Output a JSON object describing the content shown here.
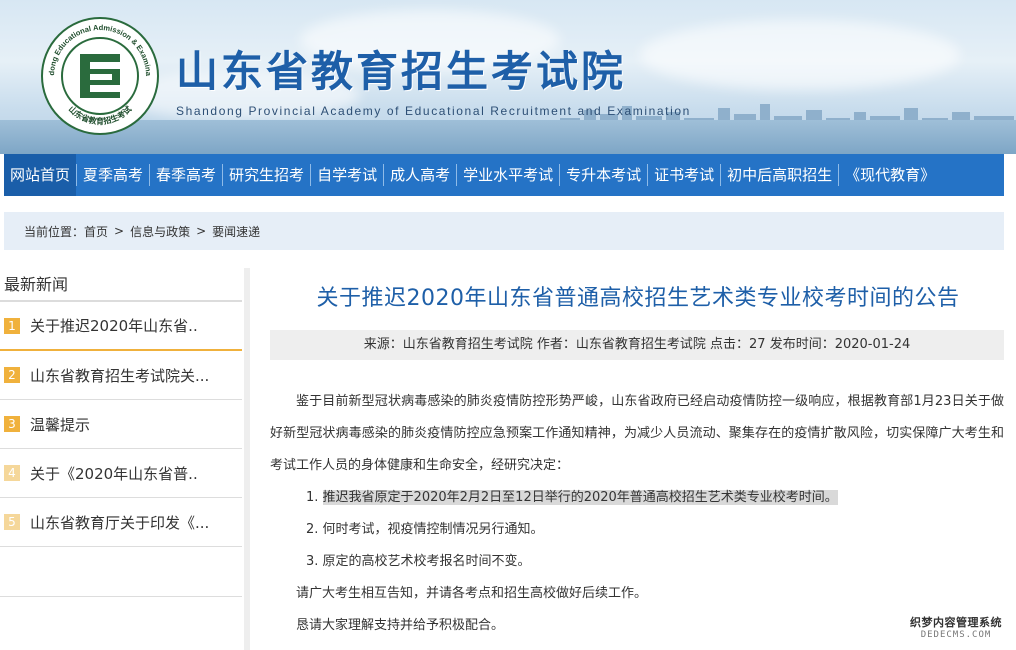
{
  "header": {
    "title": "山东省教育招生考试院",
    "subtitle": "Shandong Provincial Academy of Educational Recruitment and Examination",
    "logo": {
      "ring_text": "Shandong Educational Admission & Examinations",
      "inner_text": "山东省教育招生考试",
      "letter": "E"
    }
  },
  "nav": {
    "items": [
      {
        "label": "网站首页",
        "active": true
      },
      {
        "label": "夏季高考"
      },
      {
        "label": "春季高考"
      },
      {
        "label": "研究生招考"
      },
      {
        "label": "自学考试"
      },
      {
        "label": "成人高考"
      },
      {
        "label": "学业水平考试"
      },
      {
        "label": "专升本考试"
      },
      {
        "label": "证书考试"
      },
      {
        "label": "初中后高职招生"
      },
      {
        "label": "《现代教育》"
      }
    ]
  },
  "breadcrumb": {
    "prefix": "当前位置：",
    "items": [
      "首页",
      "信息与政策",
      "要闻速递"
    ],
    "sep": ">"
  },
  "sidebar": {
    "title": "最新新闻",
    "items": [
      {
        "num": "1",
        "label": "关于推迟2020年山东省.."
      },
      {
        "num": "2",
        "label": "山东省教育招生考试院关..."
      },
      {
        "num": "3",
        "label": "温馨提示"
      },
      {
        "num": "4",
        "label": "关于《2020年山东省普.."
      },
      {
        "num": "5",
        "label": "山东省教育厅关于印发《..."
      }
    ]
  },
  "article": {
    "title": "关于推迟2020年山东省普通高校招生艺术类专业校考时间的公告",
    "meta": "来源：山东省教育招生考试院 作者：山东省教育招生考试院 点击：27 发布时间：2020-01-24",
    "intro": "鉴于目前新型冠状病毒感染的肺炎疫情防控形势严峻，山东省政府已经启动疫情防控一级响应，根据教育部1月23日关于做好新型冠状病毒感染的肺炎疫情防控应急预案工作通知精神，为减少人员流动、聚集存在的疫情扩散风险，切实保障广大考生和考试工作人员的身体健康和生命安全，经研究决定：",
    "items": [
      {
        "num": "1.",
        "text": "推迟我省原定于2020年2月2日至12日举行的2020年普通高校招生艺术类专业校考时间。"
      },
      {
        "num": "2.",
        "text": "何时考试，视疫情控制情况另行通知。"
      },
      {
        "num": "3.",
        "text": "原定的高校艺术校考报名时间不变。"
      }
    ],
    "closing1": "请广大考生相互告知，并请各考点和招生高校做好后续工作。",
    "closing2": "恳请大家理解支持并给予积极配合。"
  },
  "watermark": {
    "cn": "织梦内容管理系统",
    "en": "DEDECMS.COM"
  },
  "colors": {
    "nav_bg": "#2573c6",
    "title_blue": "#1e5fa8",
    "accent_orange": "#f0b13c",
    "breadcrumb_bg": "#e6eef7"
  }
}
